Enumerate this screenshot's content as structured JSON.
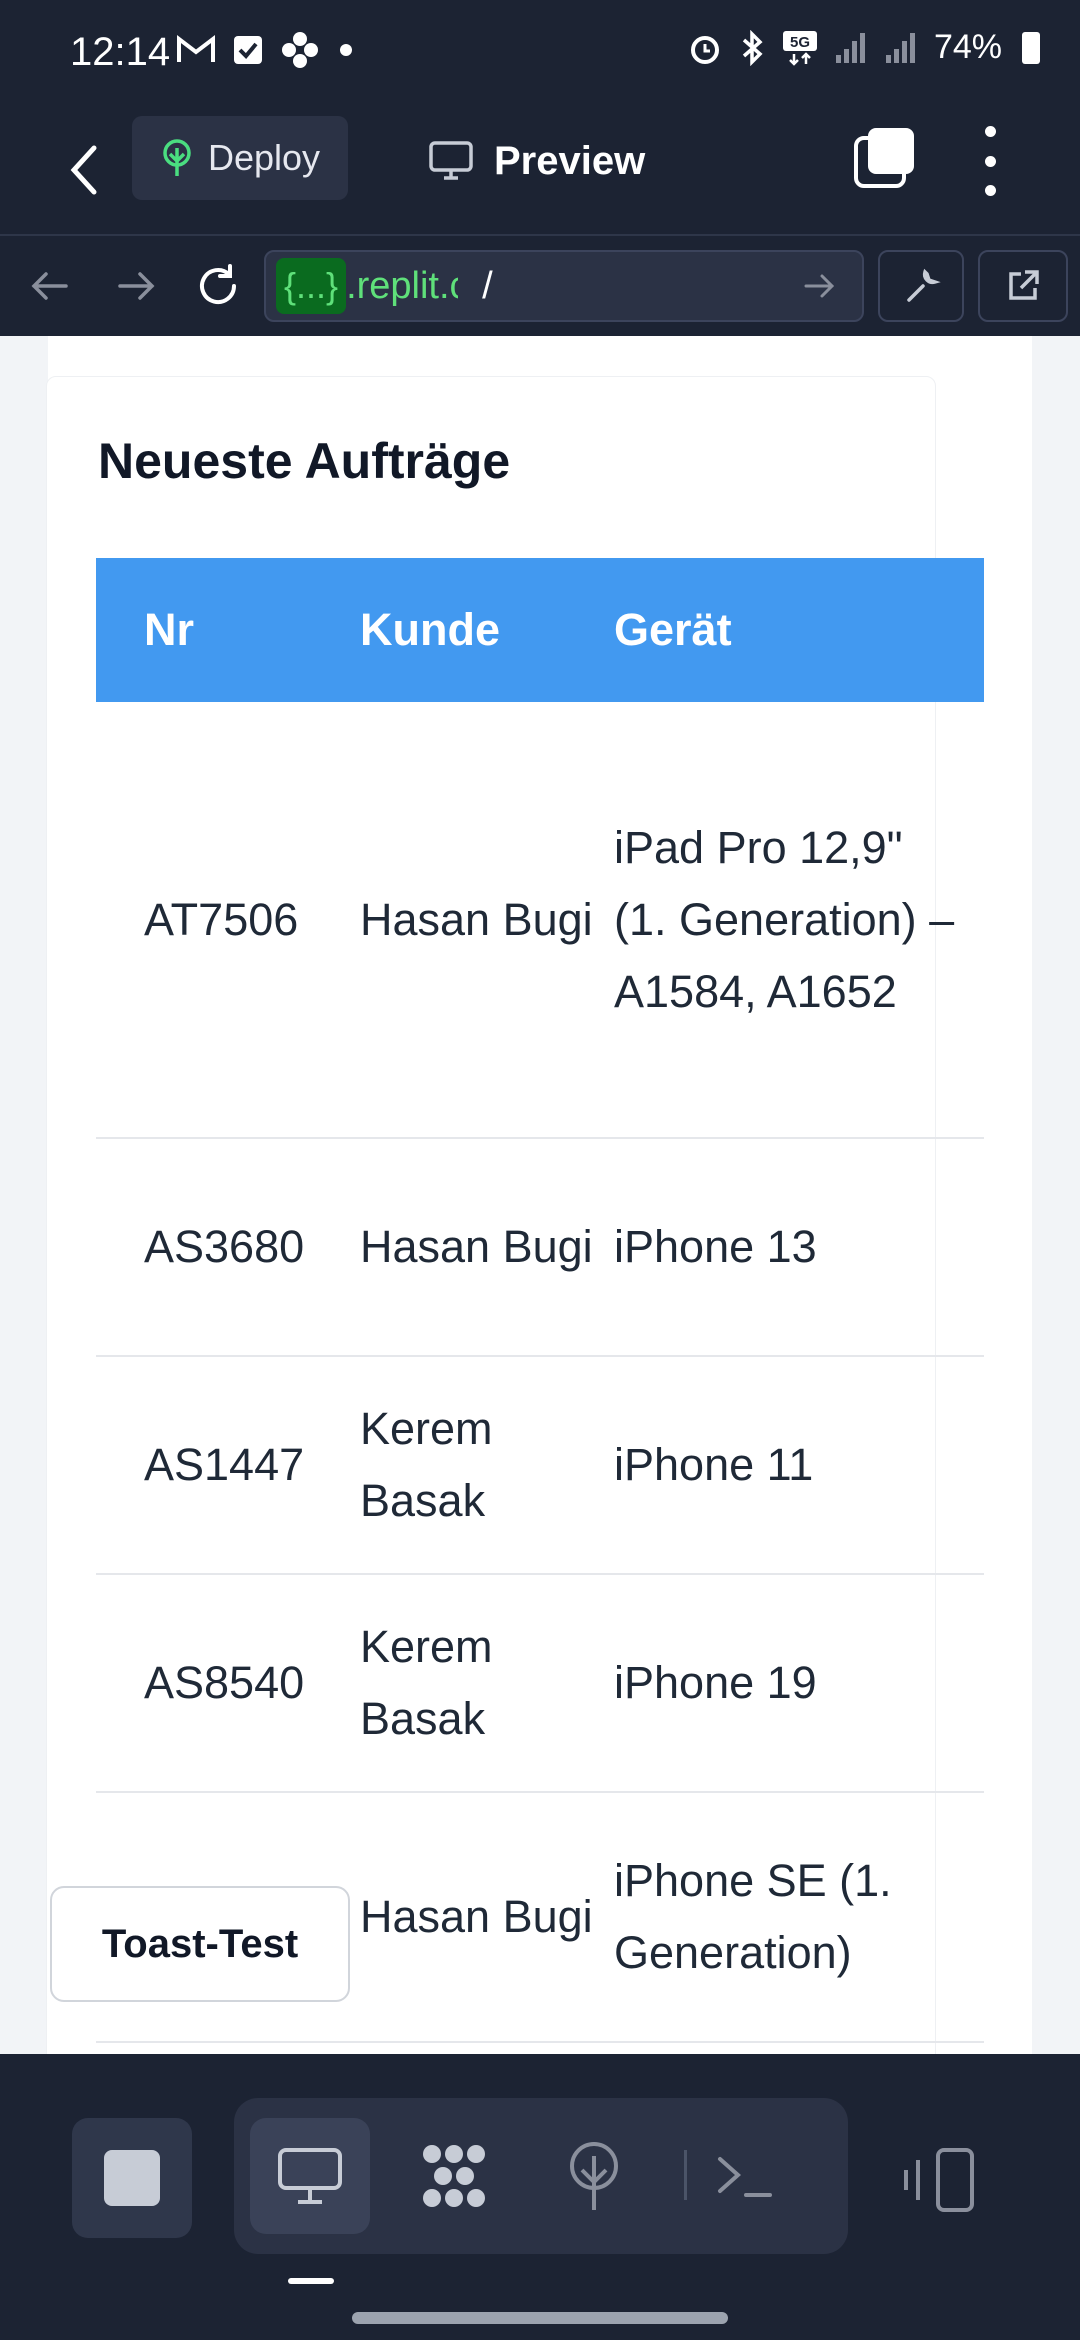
{
  "status_bar": {
    "time": "12:14",
    "battery": "74%",
    "left_icons": [
      "gmail-icon",
      "checkbox-icon",
      "flower-icon",
      "dot-icon"
    ],
    "right_icons": [
      "alarm-icon",
      "bluetooth-icon",
      "5g-icon",
      "signal-icon",
      "signal-icon",
      "battery-icon"
    ]
  },
  "toolbar": {
    "deploy_label": "Deploy",
    "preview_label": "Preview"
  },
  "url_bar": {
    "badge": "{...}",
    "host": ".replit.c",
    "path": "/"
  },
  "main": {
    "title": "Neueste Aufträge",
    "table": {
      "headers": [
        "Nr",
        "Kunde",
        "Gerät"
      ],
      "rows": [
        {
          "nr": "AT7506",
          "customer": "Hasan Bugi",
          "device": "iPad Pro 12,9\" (1. Generation) – A1584, A1652"
        },
        {
          "nr": "AS3680",
          "customer": "Hasan Bugi",
          "device": "iPhone 13"
        },
        {
          "nr": "AS1447",
          "customer": "Kerem Basak",
          "device": "iPhone 11"
        },
        {
          "nr": "AS8540",
          "customer": "Kerem Basak",
          "device": "iPhone 19"
        },
        {
          "nr": "",
          "customer": "Hasan Bugi",
          "device": "iPhone SE (1. Generation)"
        }
      ]
    },
    "toast_button": "Toast-Test"
  },
  "colors": {
    "background": "#1c2333",
    "header_blue": "#4299f0",
    "url_green": "#5fe07a"
  }
}
